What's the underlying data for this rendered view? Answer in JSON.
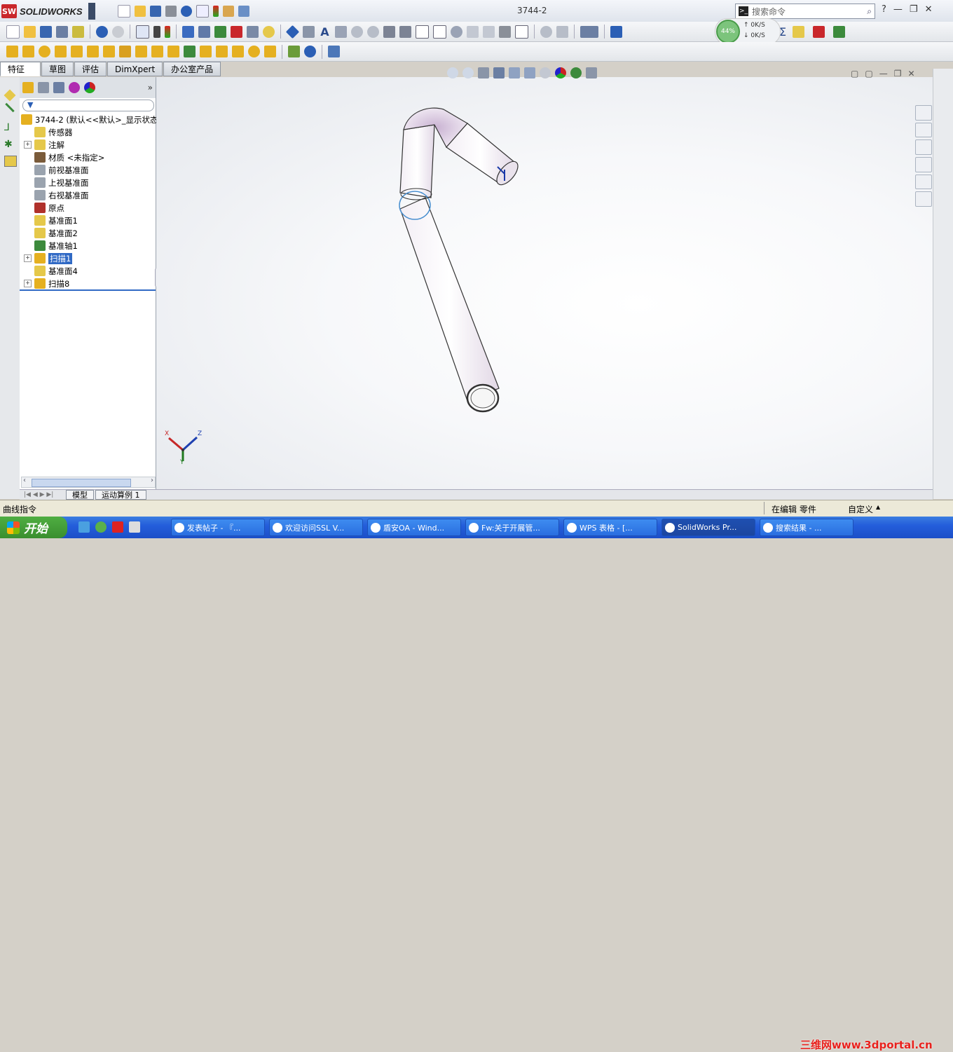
{
  "app": {
    "name": "SOLIDWORKS",
    "logo_text": "SW",
    "document_title": "3744-2"
  },
  "search": {
    "placeholder": "搜索命令",
    "prompt_icon": ">_"
  },
  "window_controls": [
    "?",
    "—",
    "❐",
    "✕"
  ],
  "net_meter": {
    "percent": "44%",
    "up": "0K/S",
    "down": "0K/S"
  },
  "cmd_tabs": [
    {
      "label": "特征",
      "active": true
    },
    {
      "label": "草图",
      "active": false
    },
    {
      "label": "评估",
      "active": false
    },
    {
      "label": "DimXpert",
      "active": false
    },
    {
      "label": "办公室产品",
      "active": false
    }
  ],
  "panel_tabs_more": "»",
  "tree": {
    "root": "3744-2  (默认<<默认>_显示状态",
    "items": [
      {
        "label": "传感器",
        "expand": false,
        "icon_color": "#e5c84a"
      },
      {
        "label": "注解",
        "expand": true,
        "icon_color": "#e5c84a"
      },
      {
        "label": "材质 <未指定>",
        "expand": false,
        "icon_color": "#7a5b3a"
      },
      {
        "label": "前视基准面",
        "expand": false,
        "icon_color": "#9aa3ae"
      },
      {
        "label": "上视基准面",
        "expand": false,
        "icon_color": "#9aa3ae"
      },
      {
        "label": "右视基准面",
        "expand": false,
        "icon_color": "#9aa3ae"
      },
      {
        "label": "原点",
        "expand": false,
        "icon_color": "#b0312b"
      },
      {
        "label": "基准面1",
        "expand": false,
        "icon_color": "#e5c84a"
      },
      {
        "label": "基准面2",
        "expand": false,
        "icon_color": "#e5c84a"
      },
      {
        "label": "基准轴1",
        "expand": false,
        "icon_color": "#3c8a3c"
      },
      {
        "label": "扫描1",
        "expand": true,
        "icon_color": "#e5b020",
        "selected": true
      },
      {
        "label": "基准面4",
        "expand": false,
        "icon_color": "#e5c84a"
      },
      {
        "label": "扫描8",
        "expand": true,
        "icon_color": "#e5b020"
      }
    ]
  },
  "bottom_tabs": {
    "nav": "|◀ ◀ ▶ ▶|",
    "tabs": [
      "模型",
      "运动算例 1"
    ]
  },
  "status": {
    "left": "曲线指令",
    "mode": "在编辑 零件",
    "custom": "自定义",
    "custom_arrow": "▲"
  },
  "triad": {
    "x": "X",
    "y": "Y",
    "z": "Z"
  },
  "taskbar": {
    "start": "开始",
    "tasks": [
      {
        "label": "发表帖子 - 『...",
        "active": false
      },
      {
        "label": "欢迎访问SSL V...",
        "active": false
      },
      {
        "label": "盾安OA - Wind...",
        "active": false
      },
      {
        "label": "Fw:关于开展管...",
        "active": false
      },
      {
        "label": "WPS 表格 - [...",
        "active": false
      },
      {
        "label": "SolidWorks Pr...",
        "active": true
      },
      {
        "label": "搜索结果 - ...",
        "active": false
      }
    ],
    "watermark": "三维网www.3dportal.cn"
  }
}
